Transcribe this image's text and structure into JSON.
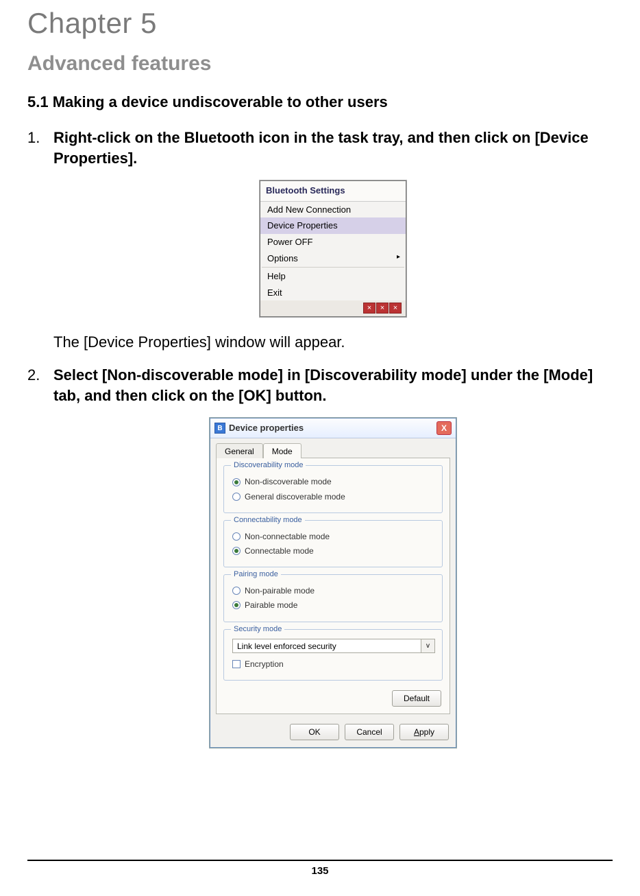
{
  "chapter": "Chapter 5",
  "heading": "Advanced features",
  "subsection": "5.1  Making a device undiscoverable to other users",
  "steps": {
    "s1": {
      "num": "1.",
      "text": "Right-click on the Bluetooth icon in the task tray, and then click on [Device Properties].",
      "after": "The [Device Properties] window will appear."
    },
    "s2": {
      "num": "2.",
      "text": "Select [Non-discoverable mode] in [Discoverability mode] under the [Mode] tab, and then click on the [OK] button."
    }
  },
  "ctx": {
    "title": "Bluetooth Settings",
    "items": {
      "add": "Add New Connection",
      "devprops": "Device Properties",
      "power": "Power OFF",
      "options": "Options",
      "help": "Help",
      "exit": "Exit"
    },
    "caret": "▸"
  },
  "dlg": {
    "title": "Device properties",
    "icon_glyph": "B",
    "close_glyph": "X",
    "tabs": {
      "general": "General",
      "mode": "Mode"
    },
    "g1": {
      "legend": "Discoverability mode",
      "r1": "Non-discoverable mode",
      "r2": "General discoverable mode"
    },
    "g2": {
      "legend": "Connectability mode",
      "r1": "Non-connectable mode",
      "r2": "Connectable mode"
    },
    "g3": {
      "legend": "Pairing mode",
      "r1": "Non-pairable mode",
      "r2": "Pairable mode"
    },
    "g4": {
      "legend": "Security mode",
      "select": "Link level enforced security",
      "select_caret": "v",
      "enc": "Encryption"
    },
    "default_btn": "Default",
    "ok": "OK",
    "cancel": "Cancel",
    "apply": "Apply"
  },
  "page_number": "135"
}
